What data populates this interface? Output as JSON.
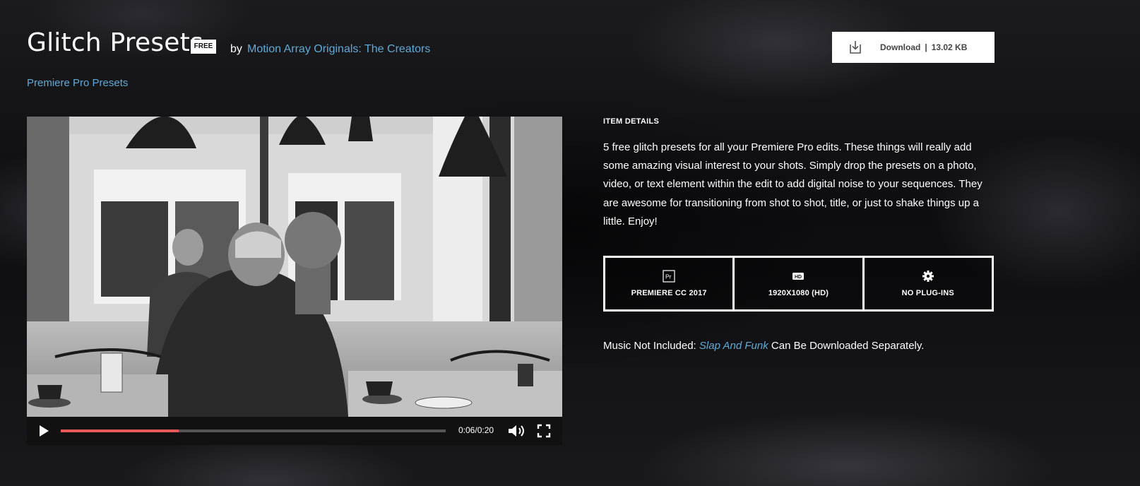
{
  "header": {
    "title": "Glitch Presets",
    "badge": "FREE",
    "by_label": "by",
    "author": "Motion Array Originals: The Creators",
    "category": "Premiere Pro Presets"
  },
  "download": {
    "label": "Download",
    "separator": "|",
    "size": "13.02 KB",
    "icon": "download-icon"
  },
  "player": {
    "time": "0:06/0:20",
    "progress": 0.307,
    "icons": [
      "play-icon",
      "volume-icon",
      "fullscreen-icon"
    ],
    "progress_color": "#e85a5a"
  },
  "details": {
    "heading": "ITEM DETAILS",
    "description": "5 free glitch presets for all your Premiere Pro edits. These things will really add some amazing visual interest to your shots. Simply drop the presets on a photo, video, or text element within the edit to add digital noise to your sequences. They are awesome for transitioning from shot to shot, title, or just to shake things up a little. Enjoy!",
    "specs": [
      {
        "icon": "premiere-pro-icon",
        "icon_text": "Pr",
        "label": "PREMIERE CC 2017"
      },
      {
        "icon": "hd-icon",
        "icon_text": "HD",
        "label": "1920X1080 (HD)"
      },
      {
        "icon": "gear-icon",
        "label": "NO PLUG-INS"
      }
    ]
  },
  "music": {
    "prefix": "Music Not Included:",
    "track": "Slap And Funk",
    "suffix": "Can Be Downloaded Separately."
  },
  "colors": {
    "link": "#5fa9d6",
    "background": "#121214"
  }
}
